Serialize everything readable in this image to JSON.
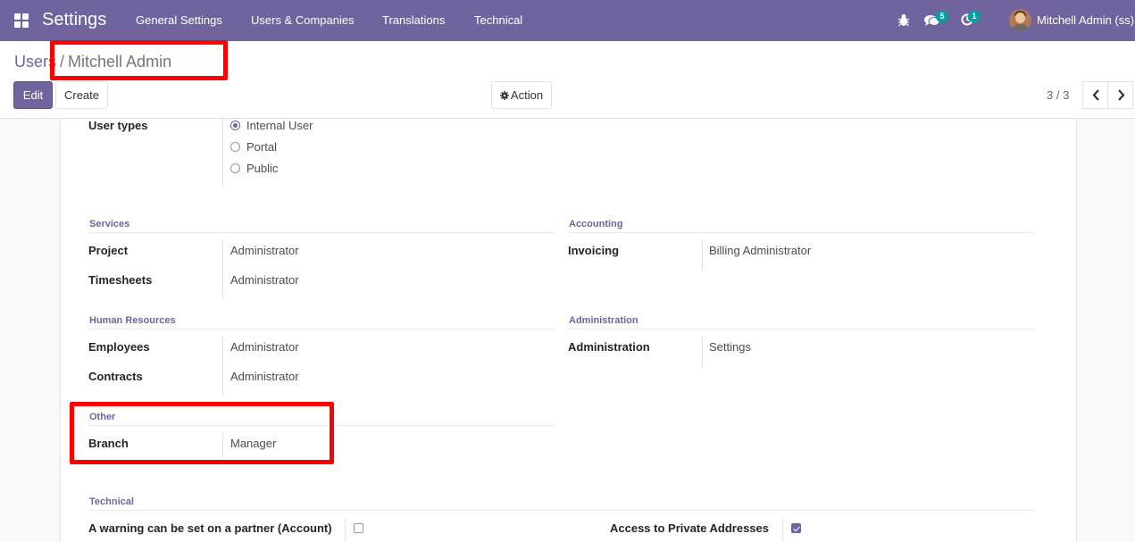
{
  "navbar": {
    "app_name": "Settings",
    "menu": [
      "General Settings",
      "Users & Companies",
      "Translations",
      "Technical"
    ],
    "messages_count": "5",
    "activities_count": "1",
    "user_name": "Mitchell Admin (ss)"
  },
  "breadcrumb": {
    "parent": "Users",
    "separator": "/",
    "current": "Mitchell Admin"
  },
  "buttons": {
    "edit": "Edit",
    "create": "Create",
    "action": "Action"
  },
  "pager": {
    "value": "3 / 3"
  },
  "form": {
    "user_types": {
      "label": "User types",
      "options": [
        "Internal User",
        "Portal",
        "Public"
      ],
      "selected": "Internal User"
    },
    "services": {
      "title": "Services",
      "rows": [
        {
          "label": "Project",
          "value": "Administrator"
        },
        {
          "label": "Timesheets",
          "value": "Administrator"
        }
      ]
    },
    "accounting": {
      "title": "Accounting",
      "rows": [
        {
          "label": "Invoicing",
          "value": "Billing Administrator"
        }
      ]
    },
    "human_resources": {
      "title": "Human Resources",
      "rows": [
        {
          "label": "Employees",
          "value": "Administrator"
        },
        {
          "label": "Contracts",
          "value": "Administrator"
        }
      ]
    },
    "administration": {
      "title": "Administration",
      "rows": [
        {
          "label": "Administration",
          "value": "Settings"
        }
      ]
    },
    "other": {
      "title": "Other",
      "rows": [
        {
          "label": "Branch",
          "value": "Manager"
        }
      ]
    },
    "technical": {
      "title": "Technical",
      "rows": [
        {
          "label": "A warning can be set on a partner (Account)",
          "checked": false
        },
        {
          "label": "Access to Private Addresses",
          "checked": true
        }
      ]
    }
  },
  "colors": {
    "primary": "#71639e",
    "badge": "#00a09d",
    "highlight": "#ff0000"
  }
}
